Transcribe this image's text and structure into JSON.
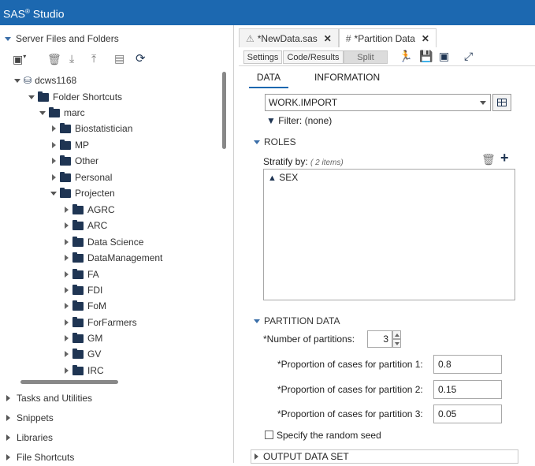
{
  "app": {
    "title_main": "SAS",
    "title_sup": "®",
    "title_rest": " Studio"
  },
  "left_panel": {
    "server_header": "Server Files and Folders",
    "tree": [
      {
        "label": "dcws1168",
        "kind": "server"
      },
      {
        "label": "Folder Shortcuts",
        "kind": "shortcut"
      },
      {
        "label": "marc",
        "kind": "shortcut"
      },
      {
        "label": "Biostatistician",
        "kind": "folder"
      },
      {
        "label": "MP",
        "kind": "folder"
      },
      {
        "label": "Other",
        "kind": "folder"
      },
      {
        "label": "Personal",
        "kind": "folder"
      },
      {
        "label": "Projecten",
        "kind": "folder"
      },
      {
        "label": "AGRC",
        "kind": "folder"
      },
      {
        "label": "ARC",
        "kind": "folder"
      },
      {
        "label": "Data Science",
        "kind": "folder"
      },
      {
        "label": "DataManagement",
        "kind": "folder"
      },
      {
        "label": "FA",
        "kind": "folder"
      },
      {
        "label": "FDI",
        "kind": "folder"
      },
      {
        "label": "FoM",
        "kind": "folder"
      },
      {
        "label": "ForFarmers",
        "kind": "folder"
      },
      {
        "label": "GM",
        "kind": "folder"
      },
      {
        "label": "GV",
        "kind": "folder"
      },
      {
        "label": "IRC",
        "kind": "folder"
      }
    ],
    "sections": [
      "Tasks and Utilities",
      "Snippets",
      "Libraries",
      "File Shortcuts"
    ]
  },
  "tabs": [
    {
      "label": "*NewData.sas",
      "close": "✕"
    },
    {
      "label": "*Partition Data",
      "close": "✕"
    }
  ],
  "toolbar": {
    "settings": "Settings",
    "code_results": "Code/Results",
    "split": "Split"
  },
  "panel_tabs": {
    "data": "DATA",
    "information": "INFORMATION"
  },
  "dataset": {
    "value": "WORK.IMPORT",
    "filter": "Filter: (none)"
  },
  "roles": {
    "header": "ROLES",
    "stratify_label": "Stratify by:",
    "stratify_count": "( 2 items)",
    "items": [
      "SEX"
    ]
  },
  "partition": {
    "header": "PARTITION DATA",
    "num_label": "*Number of partitions:",
    "num_value": "3",
    "p1_label": "*Proportion of cases for partition 1:",
    "p1_value": "0.8",
    "p2_label": "*Proportion of cases for partition 2:",
    "p2_value": "0.15",
    "p3_label": "*Proportion of cases for partition 3:",
    "p3_value": "0.05",
    "seed_label": "Specify the random seed"
  },
  "output": {
    "header": "OUTPUT DATA SET"
  },
  "colors": {
    "titlebar": "#1c68b0",
    "folder": "#1f3553",
    "accent": "#3a6ea8"
  }
}
